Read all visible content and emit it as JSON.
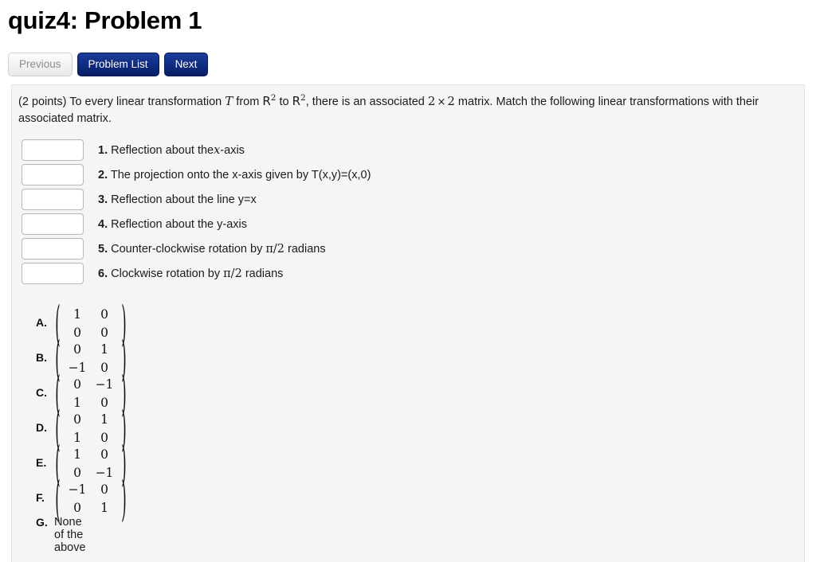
{
  "page": {
    "title": "quiz4: Problem 1"
  },
  "nav": {
    "previous_label": "Previous",
    "problem_list_label": "Problem List",
    "next_label": "Next"
  },
  "problem": {
    "points_prefix": "(2 points) To every linear transformation",
    "var_T": "T",
    "from_word": "from",
    "space_R": "R",
    "exponent": "2",
    "to_word": "to",
    "middle_text": ", there is an associated",
    "dim_left": "2",
    "times": "×",
    "dim_right": "2",
    "tail_text": "matrix. Match the following linear transformations with their associated matrix."
  },
  "matches": [
    {
      "number": "1.",
      "input_value": "",
      "input_placeholder": "",
      "text_before": "Reflection about the",
      "math": "x",
      "text_after": "-axis"
    },
    {
      "number": "2.",
      "input_value": "",
      "input_placeholder": "",
      "text_before": "The projection onto the x-axis given by T(x,y)=(x,0)",
      "math": "",
      "text_after": ""
    },
    {
      "number": "3.",
      "input_value": "",
      "input_placeholder": "",
      "text_before": "Reflection about the line y=x",
      "math": "",
      "text_after": ""
    },
    {
      "number": "4.",
      "input_value": "",
      "input_placeholder": "",
      "text_before": "Reflection about the y-axis",
      "math": "",
      "text_after": ""
    },
    {
      "number": "5.",
      "input_value": "",
      "input_placeholder": "",
      "text_before": "Counter-clockwise rotation by",
      "math": "π/2",
      "text_after": "radians"
    },
    {
      "number": "6.",
      "input_value": "",
      "input_placeholder": "",
      "text_before": "Clockwise rotation by",
      "math": "π/2",
      "text_after": "radians"
    }
  ],
  "choices": [
    {
      "letter": "A.",
      "type": "matrix",
      "cells": [
        "1",
        "0",
        "0",
        "0"
      ]
    },
    {
      "letter": "B.",
      "type": "matrix",
      "cells": [
        "0",
        "1",
        "−1",
        "0"
      ]
    },
    {
      "letter": "C.",
      "type": "matrix",
      "cells": [
        "0",
        "−1",
        "1",
        "0"
      ]
    },
    {
      "letter": "D.",
      "type": "matrix",
      "cells": [
        "0",
        "1",
        "1",
        "0"
      ]
    },
    {
      "letter": "E.",
      "type": "matrix",
      "cells": [
        "1",
        "0",
        "0",
        "−1"
      ]
    },
    {
      "letter": "F.",
      "type": "matrix",
      "cells": [
        "−1",
        "0",
        "0",
        "1"
      ]
    },
    {
      "letter": "G.",
      "type": "text",
      "text": "None of the above"
    }
  ],
  "colors": {
    "primary_button": "#12308a",
    "panel_bg": "#f5f5f5",
    "page_bg": "#ffffff",
    "disabled_text": "#8d8d8d"
  }
}
